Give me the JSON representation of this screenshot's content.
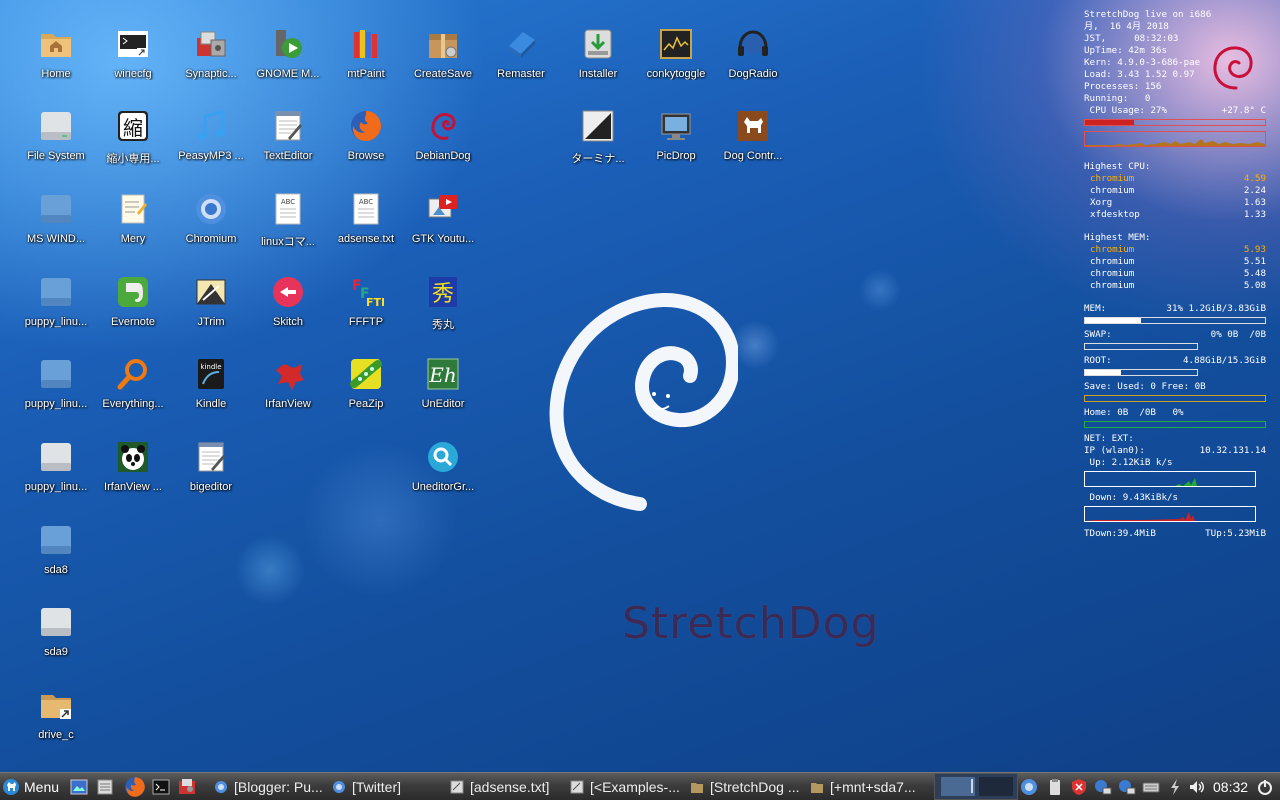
{
  "desktop": {
    "icons": [
      {
        "label": "Home"
      },
      {
        "label": "winecfg"
      },
      {
        "label": "Synaptic..."
      },
      {
        "label": "GNOME M..."
      },
      {
        "label": "mtPaint"
      },
      {
        "label": "CreateSave"
      },
      {
        "label": "Remaster"
      },
      {
        "label": "Installer"
      },
      {
        "label": "conkytoggle"
      },
      {
        "label": "DogRadio"
      },
      {
        "label": "File System"
      },
      {
        "label": "縮小専用..."
      },
      {
        "label": "PeasyMP3 ..."
      },
      {
        "label": "TextEditor"
      },
      {
        "label": "Browse"
      },
      {
        "label": "DebianDog"
      },
      {
        "label": "ターミナ..."
      },
      {
        "label": "PicDrop"
      },
      {
        "label": "Dog Contr..."
      },
      {
        "label": "MS WIND..."
      },
      {
        "label": "Mery"
      },
      {
        "label": "Chromium"
      },
      {
        "label": "linuxコマ..."
      },
      {
        "label": "adsense.txt"
      },
      {
        "label": "GTK Youtu..."
      },
      {
        "label": "puppy_linu..."
      },
      {
        "label": "Evernote"
      },
      {
        "label": "JTrim"
      },
      {
        "label": "Skitch"
      },
      {
        "label": "FFFTP"
      },
      {
        "label": "秀丸"
      },
      {
        "label": "puppy_linu..."
      },
      {
        "label": "Everything..."
      },
      {
        "label": "Kindle"
      },
      {
        "label": "IrfanView"
      },
      {
        "label": "PeaZip"
      },
      {
        "label": "UnEditor"
      },
      {
        "label": "puppy_linu..."
      },
      {
        "label": "IrfanView ..."
      },
      {
        "label": "bigeditor"
      },
      {
        "label": "UneditorGr..."
      },
      {
        "label": "sda8"
      },
      {
        "label": "sda9"
      },
      {
        "label": "drive_c"
      }
    ],
    "brand_text": "StretchDog"
  },
  "conky": {
    "header": "StretchDog live on i686",
    "date": "月,  16 4月 2018",
    "time_label": "JST,",
    "time": "08:32:03",
    "uptime": "UpTime: 42m 36s",
    "kernel": "Kern: 4.9.0-3-686-pae",
    "load": "Load: 3.43 1.52 0.97",
    "processes": "Processes: 156",
    "running": "Running:   0",
    "cpu_label": " CPU Usage: 27%",
    "cpu_temp": "+27.8° C",
    "cpu_usage": 0.27,
    "highest_cpu_title": "Highest CPU:",
    "highest_cpu": [
      {
        "name": "chromium",
        "value": "4.59"
      },
      {
        "name": "chromium",
        "value": "2.24"
      },
      {
        "name": "Xorg",
        "value": "1.63"
      },
      {
        "name": "xfdesktop",
        "value": "1.33"
      }
    ],
    "highest_mem_title": "Highest MEM:",
    "highest_mem": [
      {
        "name": "chromium",
        "value": "5.93"
      },
      {
        "name": "chromium",
        "value": "5.51"
      },
      {
        "name": "chromium",
        "value": "5.48"
      },
      {
        "name": "chromium",
        "value": "5.08"
      }
    ],
    "mem_label": "MEM:",
    "mem_value": "31% 1.2GiB/3.83GiB",
    "mem_usage": 0.31,
    "swap_label": "SWAP:",
    "swap_value": "0% 0B  /0B",
    "swap_usage": 0,
    "root_label": "ROOT:",
    "root_value": "4.88GiB/15.3GiB",
    "root_usage": 0.32,
    "save_label": "Save: Used: 0 Free: 0B",
    "home_label": "Home: 0B  /0B   0%",
    "net_label": "NET: EXT:",
    "ip_label": "IP (wlan0):",
    "ip_value": "10.32.131.14",
    "up_label": " Up: 2.12KiB k/s",
    "down_label": " Down: 9.43KiBk/s",
    "tdown": "TDown:39.4MiB",
    "tup": "TUp:5.23MiB"
  },
  "taskbar": {
    "menu_label": "Menu",
    "tasks": [
      {
        "label": "[Blogger: Pu..."
      },
      {
        "label": "[Twitter]"
      },
      {
        "label": "[adsense.txt]"
      },
      {
        "label": "[<Examples-..."
      },
      {
        "label": "[StretchDog ..."
      },
      {
        "label": "[+mnt+sda7..."
      }
    ],
    "clock": "08:32"
  },
  "colors": {
    "cpu_bar": "#cc2222",
    "graph_up": "#22aa33",
    "graph_down": "#cc2222",
    "save_bar": "#d0a020",
    "home_bar": "#22aa44"
  }
}
